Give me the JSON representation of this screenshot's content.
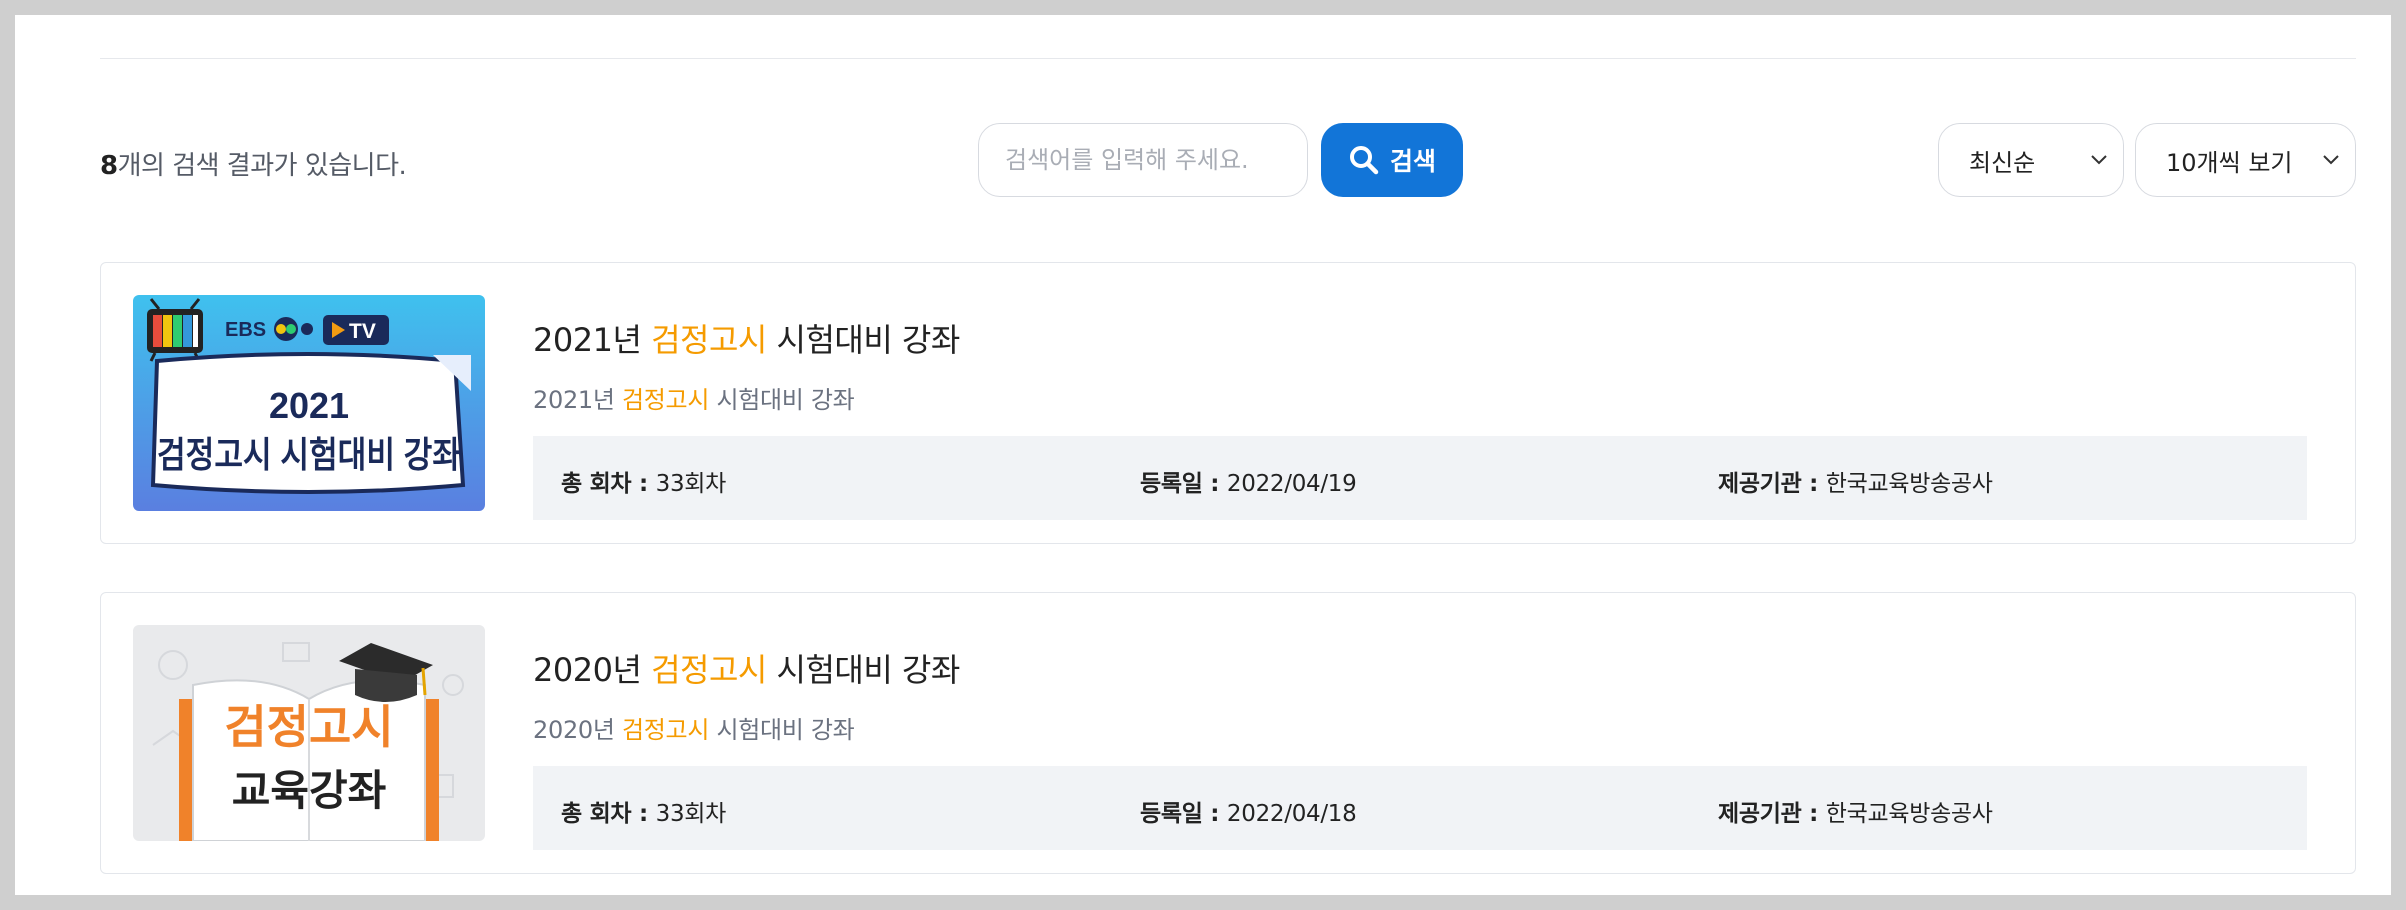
{
  "results": {
    "count": "8",
    "suffix": "개의 검색 결과가 있습니다."
  },
  "search": {
    "placeholder": "검색어를 입력해 주세요.",
    "value": "",
    "button_label": "검색"
  },
  "sort": {
    "selected": "최신순"
  },
  "per_page": {
    "selected": "10개씩 보기"
  },
  "colors": {
    "accent": "#1275d8",
    "highlight": "#f59b00"
  },
  "items": [
    {
      "title_pre": "2021년 ",
      "title_hl": "검정고시",
      "title_post": " 시험대비 강좌",
      "sub_pre": "2021년 ",
      "sub_hl": "검정고시",
      "sub_post": " 시험대비 강좌",
      "episodes_label": "총 회차 : ",
      "episodes": "33회차",
      "date_label": "등록일 : ",
      "date": "2022/04/19",
      "provider_label": "제공기관 : ",
      "provider": "한국교육방송공사",
      "thumb": {
        "brand": "EBS",
        "tv": "TV",
        "year": "2021",
        "caption": "검정고시 시험대비 강좌"
      }
    },
    {
      "title_pre": "2020년 ",
      "title_hl": "검정고시",
      "title_post": " 시험대비 강좌",
      "sub_pre": "2020년 ",
      "sub_hl": "검정고시",
      "sub_post": " 시험대비 강좌",
      "episodes_label": "총 회차 : ",
      "episodes": "33회차",
      "date_label": "등록일 : ",
      "date": "2022/04/18",
      "provider_label": "제공기관 : ",
      "provider": "한국교육방송공사",
      "thumb": {
        "line1": "검정고시",
        "line2": "교육강좌"
      }
    }
  ]
}
